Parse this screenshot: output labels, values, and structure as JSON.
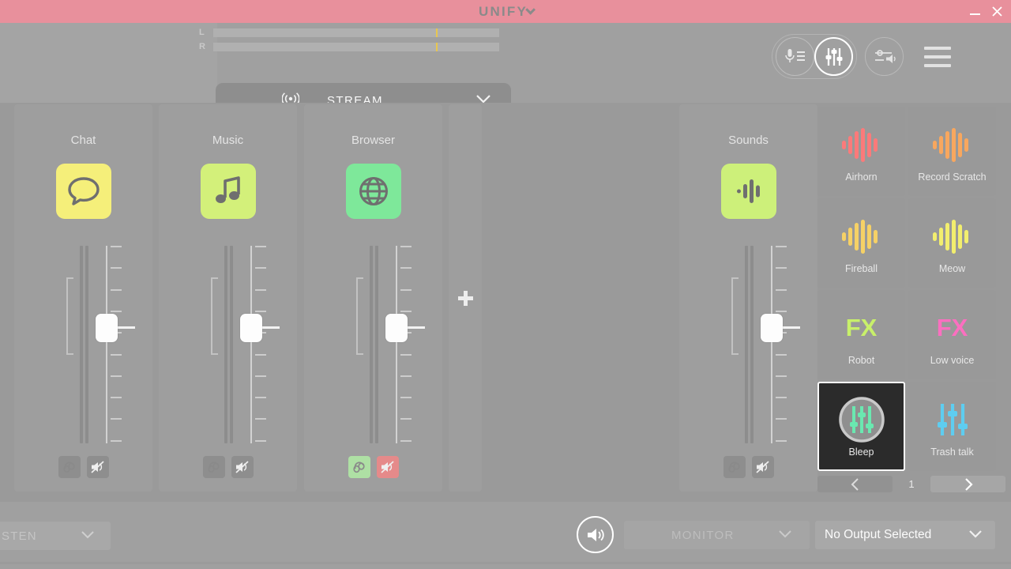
{
  "titlebar": {
    "app_name": "UNIFY",
    "minimize_label": "–",
    "close_label": "×"
  },
  "master_meters": {
    "left_label": "L",
    "right_label": "R",
    "left_level_pct": 78,
    "right_level_pct": 78,
    "fill_gradient_start": "#d7f07a",
    "fill_gradient_end": "#f5e46e",
    "track_color": "#b0b0b0"
  },
  "stream_tab": {
    "label": "STREAM",
    "broadcast_icon": "broadcast-icon",
    "chevron_icon": "chevron-down-icon"
  },
  "top_actions": {
    "mic_list_button": "mic-list-icon",
    "mixer_button": "mixer-sliders-icon",
    "eq_button": "eq-volume-icon",
    "menu_button": "hamburger-menu-icon"
  },
  "channels": [
    {
      "name": "Chat",
      "icon": "chat-bubble-icon",
      "tile_color": "#f5ef7a",
      "icon_color": "#6f6f6f",
      "fader_pos_pct": 40,
      "monitor_active": false,
      "mute_active": false,
      "monitor_icon": "headphones-icon",
      "mute_icon": "speaker-mute-icon"
    },
    {
      "name": "Music",
      "icon": "music-note-icon",
      "tile_color": "#d3f07a",
      "icon_color": "#6f6f6f",
      "fader_pos_pct": 40,
      "monitor_active": false,
      "mute_active": false,
      "monitor_icon": "headphones-icon",
      "mute_icon": "speaker-mute-icon"
    },
    {
      "name": "Browser",
      "icon": "globe-icon",
      "tile_color": "#7ee89a",
      "icon_color": "#6f6f6f",
      "fader_pos_pct": 40,
      "monitor_active": true,
      "mute_active": true,
      "monitor_icon": "headphones-icon",
      "mute_icon": "speaker-mute-icon"
    },
    {
      "name": "Sounds",
      "icon": "waveform-icon",
      "tile_color": "#cdf07a",
      "icon_color": "#6f6f6f",
      "fader_pos_pct": 40,
      "monitor_active": false,
      "mute_active": false,
      "monitor_icon": "headphones-icon",
      "mute_icon": "speaker-mute-icon"
    }
  ],
  "add_channel": {
    "icon": "plus-icon"
  },
  "soundboard": {
    "pads": [
      {
        "label": "Airhorn",
        "icon": "waveform-icon",
        "color": "#fb7a7a",
        "selected": false
      },
      {
        "label": "Record Scratch",
        "icon": "waveform-icon",
        "color": "#f8a75e",
        "selected": false
      },
      {
        "label": "Fireball",
        "icon": "waveform-icon",
        "color": "#f6d166",
        "selected": false
      },
      {
        "label": "Meow",
        "icon": "waveform-icon",
        "color": "#f2ee6e",
        "selected": false
      },
      {
        "label": "Robot",
        "icon": "fx-text-icon",
        "color": "#c8f06a",
        "selected": false,
        "glyph": "FX"
      },
      {
        "label": "Low voice",
        "icon": "fx-text-icon",
        "color": "#fb6fc0",
        "selected": false,
        "glyph": "FX"
      },
      {
        "label": "Bleep",
        "icon": "circled-sliders-icon",
        "color": "#6ae8b0",
        "selected": true
      },
      {
        "label": "Trash talk",
        "icon": "sliders-icon",
        "color": "#5ecdf0",
        "selected": false
      }
    ],
    "pager": {
      "prev_icon": "chevron-left-icon",
      "next_icon": "chevron-right-icon",
      "page_number": "1"
    }
  },
  "bottombar": {
    "listen_dropdown": {
      "label": "STEN",
      "chevron_icon": "chevron-down-icon"
    },
    "speaker_button": {
      "icon": "speaker-volume-icon"
    },
    "monitor_dropdown": {
      "label": "MONITOR",
      "chevron_icon": "chevron-down-icon"
    },
    "output_dropdown": {
      "label": "No Output Selected",
      "chevron_icon": "chevron-down-icon"
    }
  }
}
